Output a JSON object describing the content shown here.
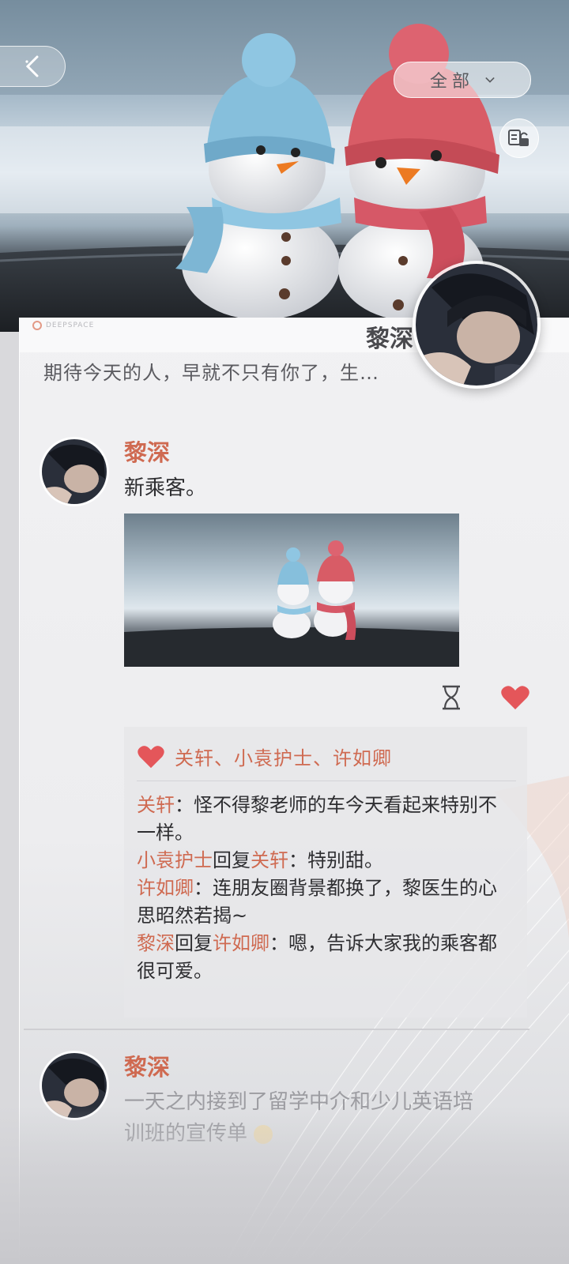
{
  "header": {
    "filter_label": "全部",
    "back_icon": "chevron-left-icon",
    "lock_icon": "unlock-icon",
    "filter_icon": "chevron-down-icon"
  },
  "profile": {
    "name": "黎深",
    "signature": "期待今天的人，早就不只有你了，生…",
    "brand": "DEEPSPACE"
  },
  "posts": [
    {
      "author": "黎深",
      "text": "新乘客。",
      "image": "two-knitted-snowmen-photo",
      "likes": "关轩、小袁护士、许如卿",
      "comments": [
        {
          "author": "关轩",
          "sep": "：",
          "text": "怪不得黎老师的车今天看起来特别不一样。"
        },
        {
          "author": "小袁护士",
          "reply_word": "回复",
          "target": "关轩",
          "sep": "：",
          "text": "特别甜。"
        },
        {
          "author": "许如卿",
          "sep": "：",
          "text": "连朋友圈背景都换了，黎医生的心思昭然若揭~"
        },
        {
          "author": "黎深",
          "reply_word": "回复",
          "target": "许如卿",
          "sep": "：",
          "text": "嗯，告诉大家我的乘客都很可爱。"
        }
      ]
    },
    {
      "author": "黎深",
      "text_line1": "一天之内接到了留学中介和少儿英语培",
      "text_line2": "训班的宣传单"
    }
  ],
  "colors": {
    "accent": "#cf6a51",
    "heart": "#e4565a",
    "text": "#2e2e31"
  }
}
